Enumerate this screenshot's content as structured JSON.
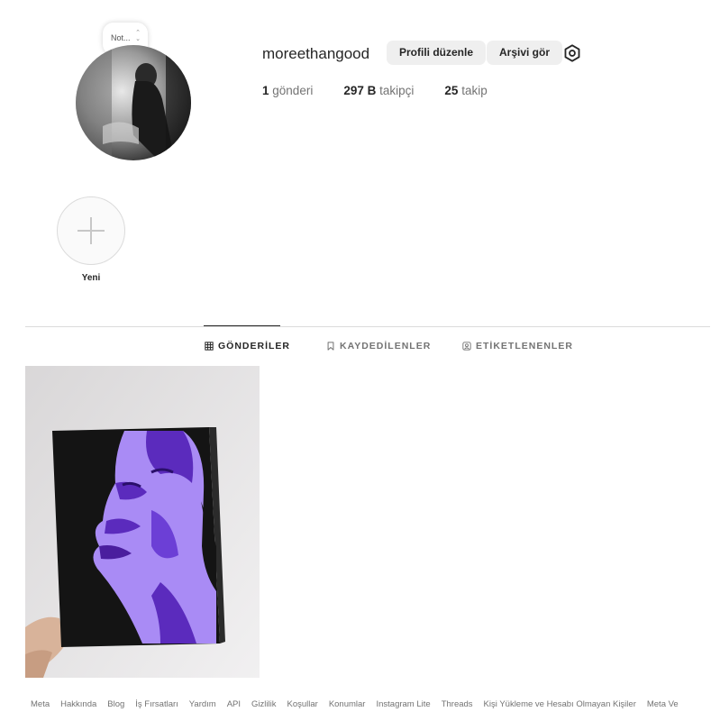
{
  "profile": {
    "username": "moreethangood",
    "note_text": "Not...",
    "edit_button": "Profili düzenle",
    "archive_button": "Arşivi gör",
    "stats": {
      "posts_count": "1",
      "posts_label": "gönderi",
      "followers_count": "297 B",
      "followers_label": "takipçi",
      "following_count": "25",
      "following_label": "takip"
    }
  },
  "highlight": {
    "new_label": "Yeni"
  },
  "tabs": [
    {
      "label": "GÖNDERİLER",
      "icon": "grid-icon",
      "active": true
    },
    {
      "label": "KAYDEDİLENLER",
      "icon": "bookmark-icon",
      "active": false
    },
    {
      "label": "ETİKETLENENLER",
      "icon": "tag-user-icon",
      "active": false
    }
  ],
  "footer": {
    "links": [
      "Meta",
      "Hakkında",
      "Blog",
      "İş Fırsatları",
      "Yardım",
      "API",
      "Gizlilik",
      "Koşullar",
      "Konumlar",
      "Instagram Lite",
      "Threads",
      "Kişi Yükleme ve Hesabı Olmayan Kişiler",
      "Meta Ve"
    ]
  },
  "colors": {
    "button_bg": "#efefef",
    "text_primary": "#262626",
    "text_secondary": "#737373",
    "art_purple": "#8b5cf6",
    "art_dark_purple": "#5b2bbd"
  }
}
